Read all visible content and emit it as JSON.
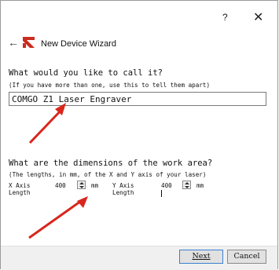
{
  "titlebar": {
    "help_label": "?",
    "close_label": "✕"
  },
  "header": {
    "back_icon": "back-arrow-icon",
    "title": "New Device Wizard",
    "app_icon": "red-app-icon"
  },
  "name_section": {
    "question": "What would you like to call it?",
    "hint": "(If you have more than one, use this to tell them apart)",
    "input_value": "COMGO Z1 Laser Engraver"
  },
  "dims_section": {
    "question": "What are the dimensions of the work area?",
    "hint": "(The lengths, in mm, of the X and Y axis of your laser)",
    "x_label": "X Axis Length",
    "x_value": "400",
    "x_unit": "mm",
    "y_label": "Y Axis Length",
    "y_value": "400",
    "y_unit": "mm"
  },
  "buttons": {
    "next": "Next",
    "cancel": "Cancel"
  },
  "colors": {
    "annotation_arrow": "#d9261c",
    "app_icon": "#cc2b1f",
    "dialog_bg": "#ffffff",
    "footer_bg": "#f0f0f0"
  }
}
